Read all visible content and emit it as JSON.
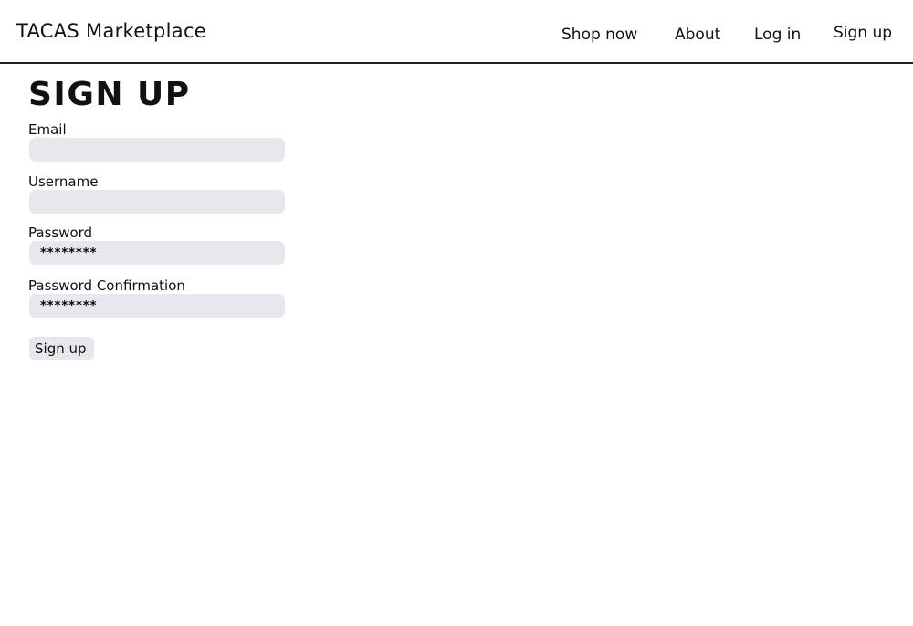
{
  "header": {
    "brand": "TACAS Marketplace",
    "nav": {
      "shop_now": "Shop now",
      "about": "About",
      "log_in": "Log in",
      "sign_up": "Sign up"
    }
  },
  "form": {
    "title": "SIGN UP",
    "email": {
      "label": "Email",
      "value": ""
    },
    "username": {
      "label": "Username",
      "value": ""
    },
    "password": {
      "label": "Password",
      "value": "********"
    },
    "password_confirmation": {
      "label": "Password Confirmation",
      "value": "********"
    },
    "submit_label": "Sign up"
  },
  "colors": {
    "input_background": "#e8e7ee",
    "header_border": "#222222"
  }
}
